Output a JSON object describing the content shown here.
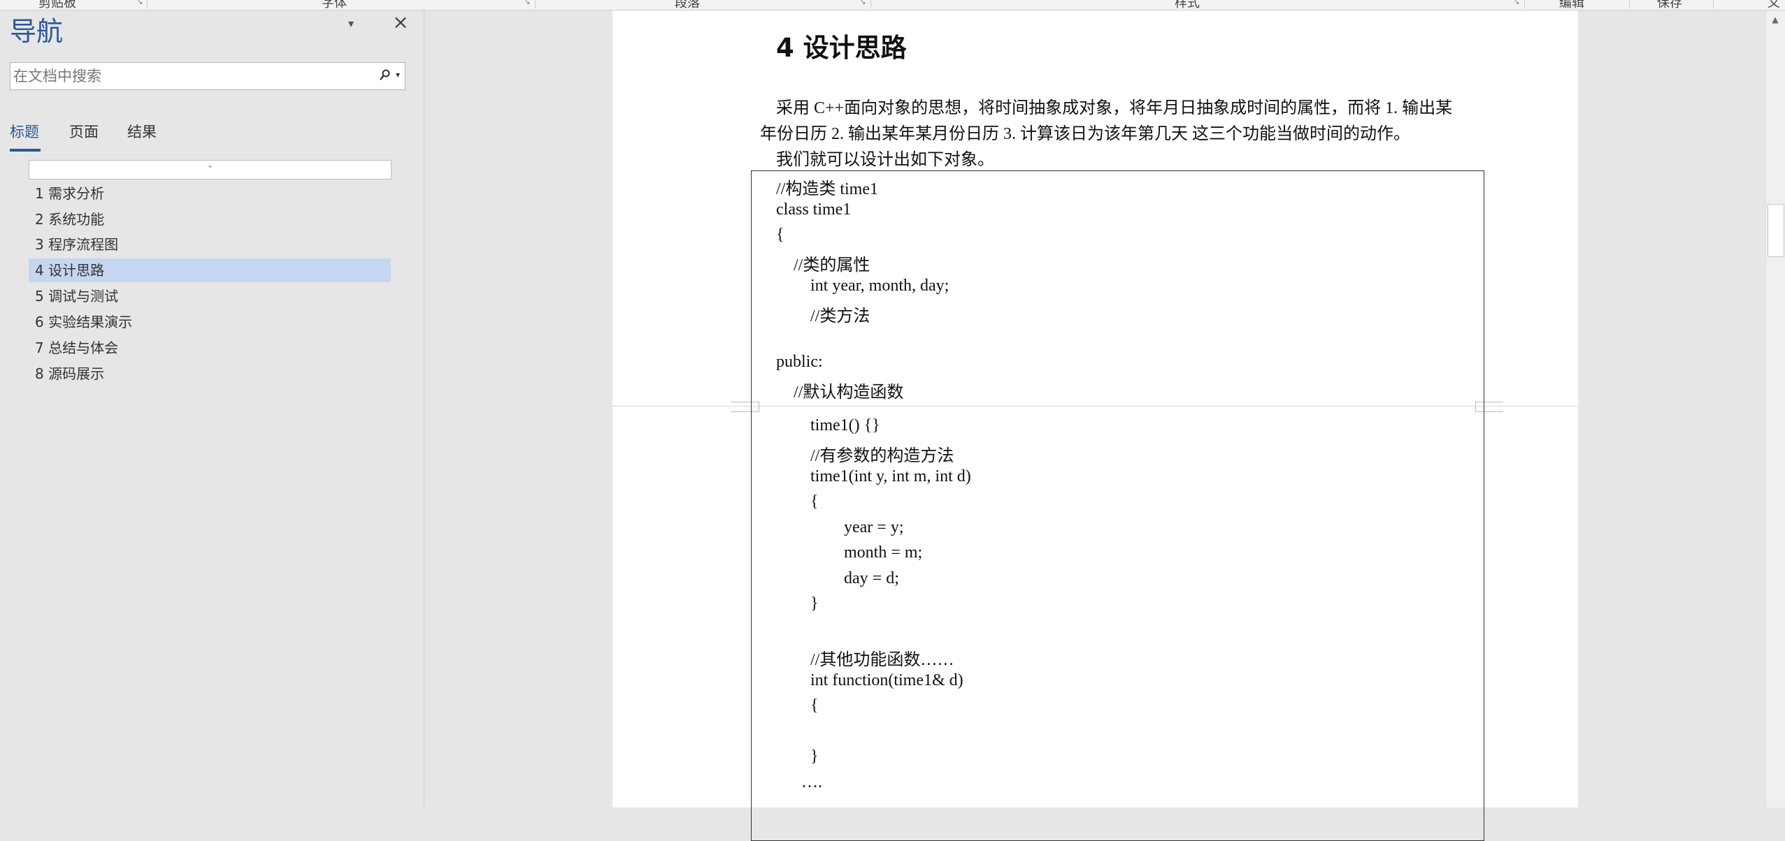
{
  "ribbon": {
    "labels": [
      "剪贴板",
      "字体",
      "段落",
      "样式",
      "编辑",
      "保存"
    ],
    "truncated_right": "义"
  },
  "nav": {
    "title": "导航",
    "search_placeholder": "在文档中搜索",
    "tabs": [
      {
        "label": "标题",
        "active": true
      },
      {
        "label": "页面",
        "active": false
      },
      {
        "label": "结果",
        "active": false
      }
    ],
    "collapse_marker": "ˆ",
    "headings": [
      {
        "label": "1 需求分析",
        "active": false
      },
      {
        "label": "2 系统功能",
        "active": false
      },
      {
        "label": "3 程序流程图",
        "active": false
      },
      {
        "label": "4 设计思路",
        "active": true
      },
      {
        "label": "5 调试与测试",
        "active": false
      },
      {
        "label": "6 实验结果演示",
        "active": false
      },
      {
        "label": "7 总结与体会",
        "active": false
      },
      {
        "label": "8 源码展示",
        "active": false
      }
    ]
  },
  "document": {
    "heading": "4   设计思路",
    "paragraph_lines": [
      "采用 C++面向对象的思想，将时间抽象成对象，将年月日抽象成时间的属性，而将 1. 输出某",
      "年份日历 2. 输出某年某月份日历 3. 计算该日为该年第几天  这三个功能当做时间的动作。",
      "我们就可以设计出如下对象。"
    ],
    "code_lines": [
      "//构造类 time1",
      "class time1",
      "{",
      "//类的属性",
      "int year, month, day;",
      "//类方法",
      "",
      "public:",
      "//默认构造函数",
      "time1() {}",
      "//有参数的构造方法",
      "time1(int y, int m, int d)",
      "{",
      "year = y;",
      "month = m;",
      "day = d;",
      "}",
      "",
      "//其他功能函数……",
      "int function(time1& d)",
      "{",
      "",
      "}",
      "…."
    ]
  },
  "colors": {
    "accent": "#2b579a",
    "active_heading_bg": "#c5d6f0",
    "pane_bg": "#e6e6e6",
    "page_bg": "#ffffff"
  },
  "icons": {
    "search": "search-icon",
    "close": "close-icon",
    "dropdown": "chevron-down-icon"
  }
}
